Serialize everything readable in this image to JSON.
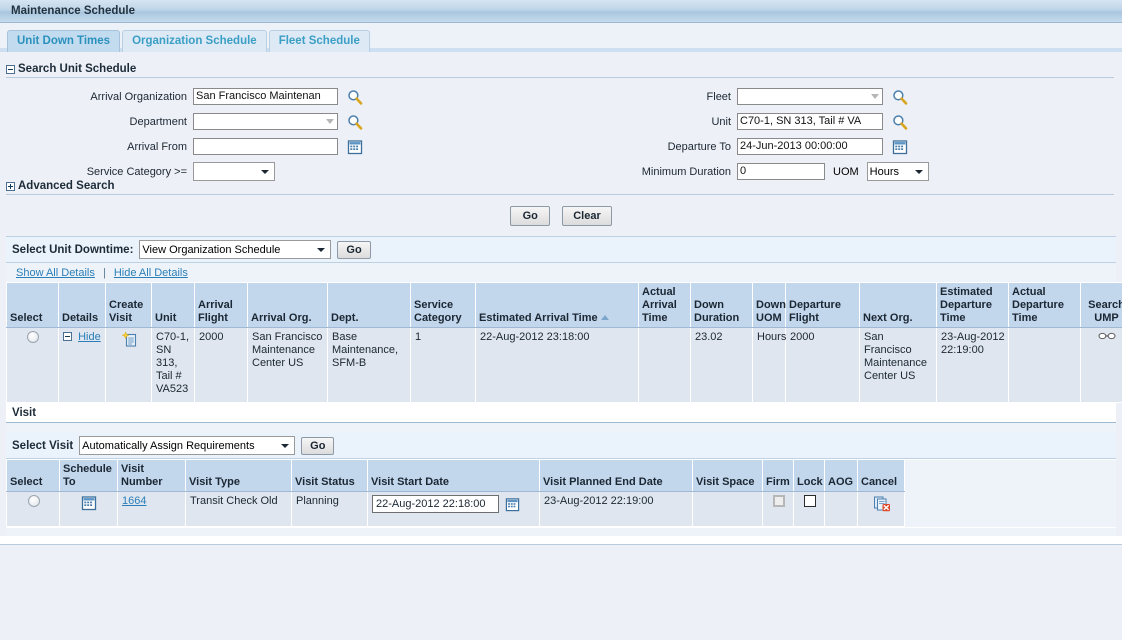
{
  "window": {
    "title": "Maintenance Schedule"
  },
  "tabs": [
    {
      "label": "Unit Down Times",
      "active": true
    },
    {
      "label": "Organization Schedule",
      "active": false
    },
    {
      "label": "Fleet Schedule",
      "active": false
    }
  ],
  "search": {
    "section_title": "Search Unit Schedule",
    "advanced_title": "Advanced Search",
    "fields": {
      "arrival_organization": {
        "label": "Arrival Organization",
        "value": "San Francisco Maintenan"
      },
      "department": {
        "label": "Department",
        "value": ""
      },
      "arrival_from": {
        "label": "Arrival From",
        "value": ""
      },
      "service_category": {
        "label": "Service Category >=",
        "value": ""
      },
      "fleet": {
        "label": "Fleet",
        "value": ""
      },
      "unit": {
        "label": "Unit",
        "value": "C70-1, SN 313, Tail # VA"
      },
      "departure_to": {
        "label": "Departure To",
        "value": "24-Jun-2013 00:00:00"
      },
      "minimum_duration": {
        "label": "Minimum Duration",
        "value": "0"
      },
      "uom": {
        "label": "UOM",
        "value": "Hours"
      }
    },
    "buttons": {
      "go": "Go",
      "clear": "Clear"
    }
  },
  "downtime_toolbar": {
    "label": "Select Unit Downtime:",
    "action_value": "View Organization Schedule",
    "go": "Go",
    "show_all": "Show All Details",
    "hide_all": "Hide All Details"
  },
  "downtime_table": {
    "headers": [
      "Select",
      "Details",
      "Create Visit",
      "Unit",
      "Arrival Flight",
      "Arrival Org.",
      "Dept.",
      "Service Category",
      "Estimated Arrival Time",
      "Actual Arrival Time",
      "Down Duration",
      "Down UOM",
      "Departure Flight",
      "Next Org.",
      "Estimated Departure Time",
      "Actual Departure Time",
      "Search UMP"
    ],
    "sorted_column": "Estimated Arrival Time",
    "sort_direction": "asc",
    "rows": [
      {
        "details_label": "Hide",
        "unit": "C70-1, SN 313, Tail # VA523",
        "arrival_flight": "2000",
        "arrival_org": "San Francisco Maintenance Center US",
        "dept": "Base Maintenance, SFM-B",
        "service_category": "1",
        "estimated_arrival_time": "22-Aug-2012 23:18:00",
        "actual_arrival_time": "",
        "down_duration": "23.02",
        "down_uom": "Hours",
        "departure_flight": "2000",
        "next_org": "San Francisco Maintenance Center US",
        "estimated_departure_time": "23-Aug-2012 22:19:00",
        "actual_departure_time": ""
      }
    ]
  },
  "visit_section": {
    "title": "Visit",
    "toolbar": {
      "label": "Select Visit",
      "action_value": "Automatically Assign Requirements",
      "go": "Go"
    },
    "headers": [
      "Select",
      "Schedule To",
      "Visit Number",
      "Visit Type",
      "Visit Status",
      "Visit Start Date",
      "Visit Planned End Date",
      "Visit Space",
      "Firm",
      "Lock",
      "AOG",
      "Cancel"
    ],
    "rows": [
      {
        "visit_number": "1664",
        "visit_type": "Transit Check Old",
        "visit_status": "Planning",
        "visit_start_date": "22-Aug-2012 22:18:00",
        "visit_planned_end_date": "23-Aug-2012 22:19:00",
        "visit_space": "",
        "firm_checked": false,
        "firm_disabled": true,
        "lock_checked": false,
        "aog": ""
      }
    ]
  },
  "colors": {
    "accent_link": "#2a7fb8",
    "header_blue": "#c2d6ec",
    "row_blue": "#dfe6ef",
    "tab_active": "#c3dbef",
    "page_bg": "#eef0f7"
  }
}
